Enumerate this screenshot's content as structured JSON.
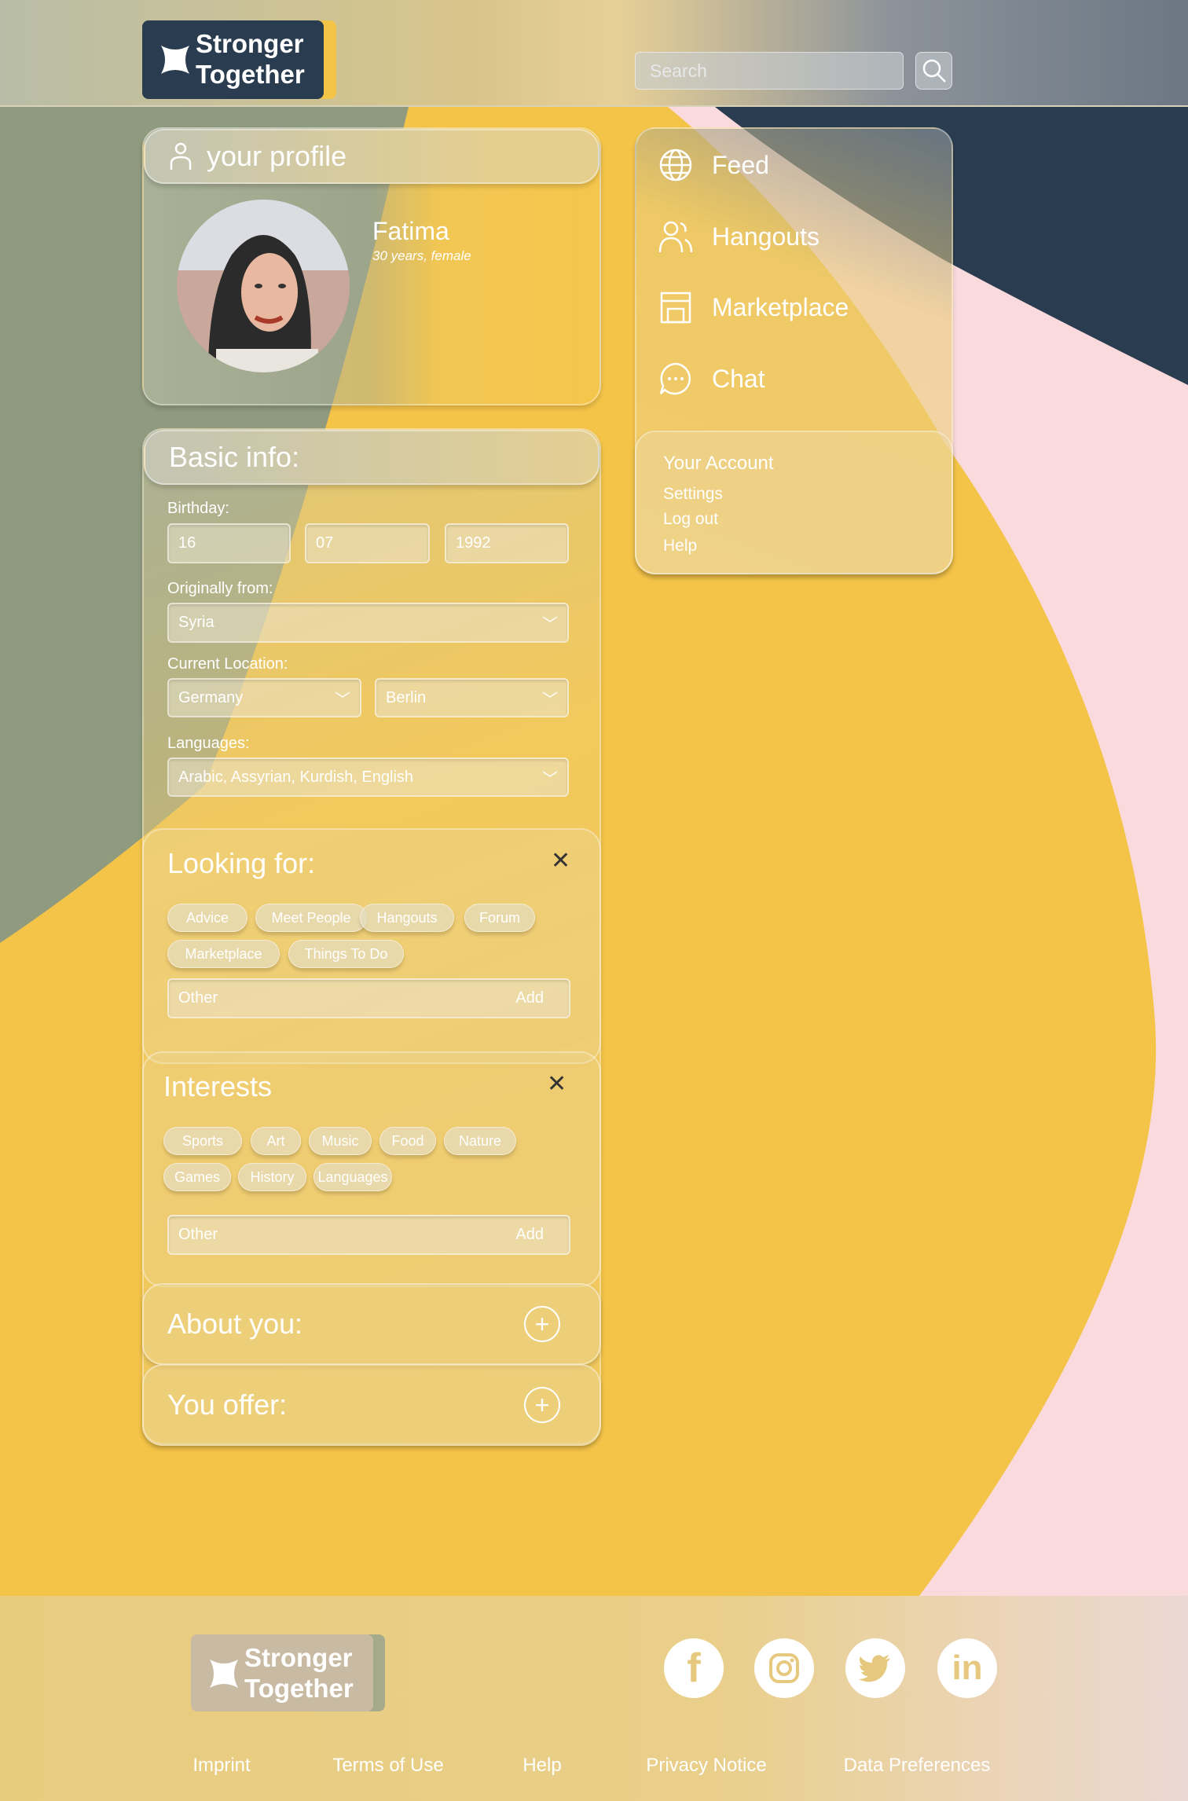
{
  "colors": {
    "yellow": "#f4c449",
    "olive": "#8f9a7f",
    "pink": "#fadadd",
    "navy": "#2a3c4f"
  },
  "header": {
    "logo_line1": "Stronger",
    "logo_line2": "Together",
    "search_placeholder": "Search",
    "search_icon": "magnifier-icon"
  },
  "profile": {
    "title": "your profile",
    "name": "Fatima",
    "meta": "30 years, female"
  },
  "basic": {
    "title": "Basic info:",
    "birthday_label": "Birthday:",
    "day": "16",
    "month": "07",
    "year": "1992",
    "origin_label": "Originally from:",
    "origin": "Syria",
    "location_label": "Current Location:",
    "country": "Germany",
    "city": "Berlin",
    "languages_label": "Languages:",
    "languages": "Arabic, Assyrian, Kurdish, English"
  },
  "looking": {
    "title": "Looking for:",
    "chips": [
      "Advice",
      "Meet People",
      "Hangouts",
      "Forum",
      "Marketplace",
      "Things To Do"
    ],
    "other": "Other",
    "add": "Add"
  },
  "interests": {
    "title": "Interests",
    "chips": [
      "Sports",
      "Art",
      "Music",
      "Food",
      "Nature",
      "Games",
      "History",
      "Languages"
    ],
    "other": "Other",
    "add": "Add"
  },
  "about": {
    "title": "About you:"
  },
  "offer": {
    "title": "You offer:"
  },
  "nav": {
    "items": [
      {
        "label": "Feed",
        "icon": "globe-icon"
      },
      {
        "label": "Hangouts",
        "icon": "people-icon"
      },
      {
        "label": "Marketplace",
        "icon": "store-icon"
      },
      {
        "label": "Chat",
        "icon": "chat-bubble-icon"
      }
    ],
    "account_title": "Your Account",
    "settings": "Settings",
    "logout": "Log out",
    "help": "Help"
  },
  "footer": {
    "logo_line1": "Stronger",
    "logo_line2": "Together",
    "social": [
      "facebook",
      "instagram",
      "twitter",
      "linkedin"
    ],
    "links": [
      "Imprint",
      "Terms of Use",
      "Help",
      "Privacy Notice",
      "Data Preferences"
    ]
  }
}
